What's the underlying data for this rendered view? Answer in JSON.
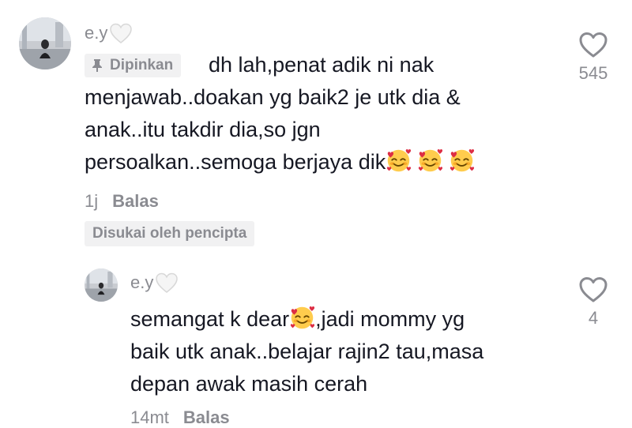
{
  "comment": {
    "username": "e.y",
    "pinned_label": "Dipinkan",
    "text_lines": [
      "dh lah,penat adik ni nak",
      "menjawab..doakan yg baik2 je utk dia &",
      "anak..itu takdir dia,so jgn",
      "persoalkan..semoga berjaya dik"
    ],
    "time": "1j",
    "reply_label": "Balas",
    "creator_badge": "Disukai oleh pencipta",
    "like_count": "545"
  },
  "reply": {
    "username": "e.y",
    "text_lines": [
      "semangat k dear",
      ",jadi mommy yg",
      "baik utk anak..belajar rajin2 tau,masa",
      "depan awak masih cerah"
    ],
    "time": "14mt",
    "reply_label": "Balas",
    "like_count": "4"
  },
  "icons": {
    "username_decoration": "white-heart-icon",
    "pin": "pin-icon",
    "like": "heart-outline-icon",
    "emoji": "smiling-face-with-hearts-emoji"
  },
  "colors": {
    "text_primary": "#161823",
    "text_secondary": "#8a8b91",
    "badge_bg": "#f1f1f2"
  }
}
